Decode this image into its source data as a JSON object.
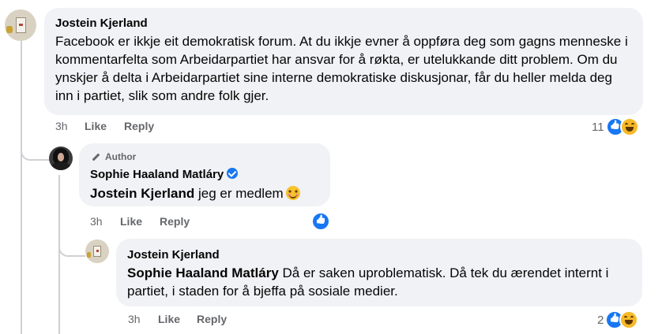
{
  "comments": [
    {
      "author": "Jostein Kjerland",
      "text": "Facebook er ikkje eit demokratisk forum. At du ikkje evner å oppføra deg som gagns menneske i kommentarfelta som Arbeidarpartiet har ansvar for å røkta, er utelukkande ditt problem. Om du ynskjer å delta i Arbeidarpartiet sine interne demokratiske diskusjonar, får du heller melda deg inn i partiet, slik som andre folk gjer.",
      "time": "3h",
      "like_label": "Like",
      "reply_label": "Reply",
      "reaction_count": "11"
    },
    {
      "badge": "Author",
      "author": "Sophie Haaland Matláry",
      "mention": "Jostein Kjerland",
      "text": " jeg er medlem",
      "time": "3h",
      "like_label": "Like",
      "reply_label": "Reply",
      "reaction_count": ""
    },
    {
      "author": "Jostein Kjerland",
      "mention": "Sophie Haaland Matláry",
      "text": " Då er saken uproblematisk. Då tek du ærendet internt i partiet, i staden for å bjeffa på sosiale medier.",
      "time": "3h",
      "like_label": "Like",
      "reply_label": "Reply",
      "reaction_count": "2"
    }
  ],
  "colors": {
    "bubble": "#f0f2f5",
    "like_blue": "#1877f2",
    "meta_gray": "#65676b",
    "thread_line": "#ced0d4"
  }
}
